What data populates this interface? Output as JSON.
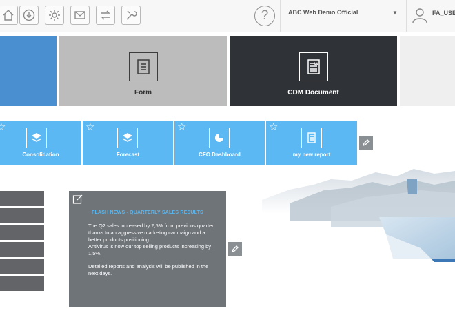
{
  "toolbar": {
    "icons": [
      "home-icon",
      "download-icon",
      "gear-icon",
      "mail-icon",
      "transfer-icon",
      "tools-icon"
    ],
    "help_label": "?",
    "environment": "ABC Web Demo Official",
    "user_name": "FA_USE"
  },
  "tiles": {
    "form_label": "Form",
    "cdm_label": "CDM Document",
    "colors": {
      "blue": "#4a90d0",
      "gray": "#bdbcbc",
      "dark": "#2f3237",
      "light": "#efefef"
    }
  },
  "reports": [
    {
      "label": "Consolidation",
      "icon": "layers-icon"
    },
    {
      "label": "Forecast",
      "icon": "layers-icon"
    },
    {
      "label": "CFO Dashboard",
      "icon": "pie-chart-icon"
    },
    {
      "label": "my new report",
      "icon": "document-icon"
    }
  ],
  "news": {
    "title": "FLASH NEWS - QUARTERLY SALES RESULTS",
    "paragraph1": "The Q2 sales increased by 2,5% from previous quarter thanks to an aggressive marketing campaign and a better products positioning.",
    "paragraph2": "Antivirus is now our top selling products increasing by 1,5%.",
    "paragraph3": "Detailed reports and analysis will be published in the next days."
  }
}
